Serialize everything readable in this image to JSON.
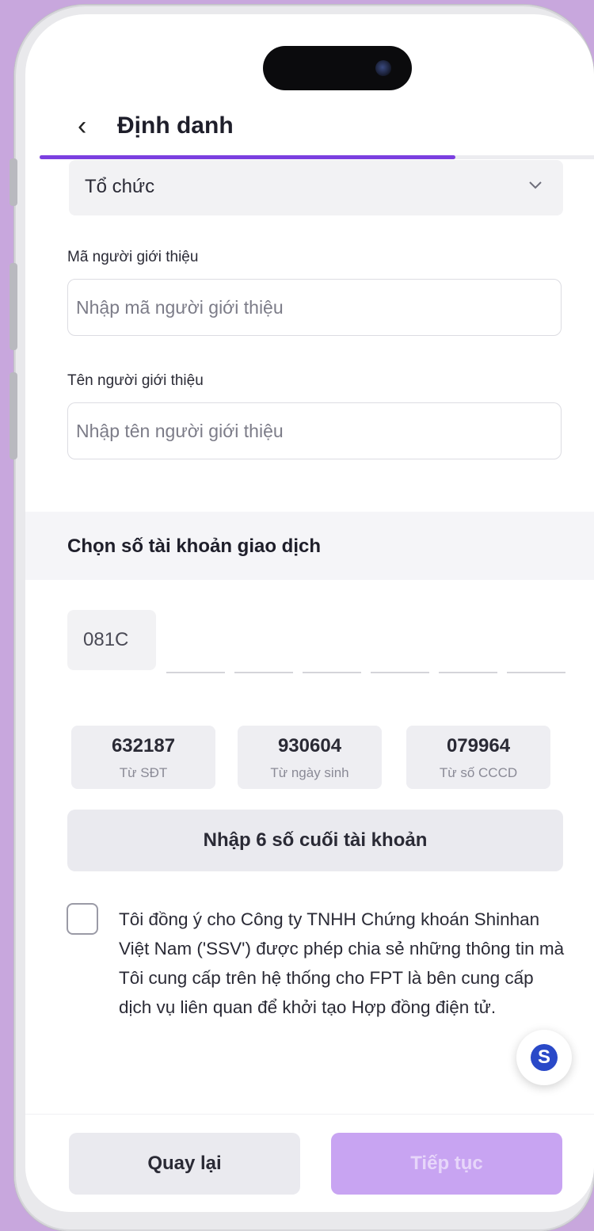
{
  "header": {
    "back_icon": "chevron-left-icon",
    "back_glyph": "‹",
    "title": "Định danh"
  },
  "customer_type": {
    "value": "Tổ chức",
    "icon": "chevron-down-icon"
  },
  "referrer_code": {
    "label": "Mã người giới thiệu",
    "placeholder": "Nhập mã người giới thiệu",
    "value": ""
  },
  "referrer_name": {
    "label": "Tên người giới thiệu",
    "placeholder": "Nhập tên người giới thiệu",
    "value": ""
  },
  "account_section": {
    "title": "Chọn số tài khoản giao dịch",
    "prefix": "081C",
    "digits": [
      "",
      "",
      "",
      "",
      "",
      ""
    ],
    "suggestions": [
      {
        "number": "632187",
        "source": "Từ SĐT"
      },
      {
        "number": "930604",
        "source": "Từ ngày sinh"
      },
      {
        "number": "079964",
        "source": "Từ số CCCD"
      }
    ],
    "enter_last6_label": "Nhập 6 số cuối tài khoản"
  },
  "consent": {
    "checked": false,
    "text": "Tôi đồng ý cho Công ty TNHH Chứng khoán Shinhan Việt Nam ('SSV') được phép chia sẻ những thông tin mà Tôi cung cấp trên hệ thống cho FPT là bên cung cấp dịch vụ liên quan để khởi tạo Hợp đồng điện tử."
  },
  "fab": {
    "icon": "shinhan-logo-icon",
    "glyph": "S"
  },
  "footer": {
    "back_label": "Quay lại",
    "next_label": "Tiếp tục"
  },
  "colors": {
    "accent": "#7b3fe0",
    "next_disabled_bg": "#c8a4f2",
    "background": "#c8a7dd"
  },
  "progress": {
    "fraction": 0.75
  }
}
